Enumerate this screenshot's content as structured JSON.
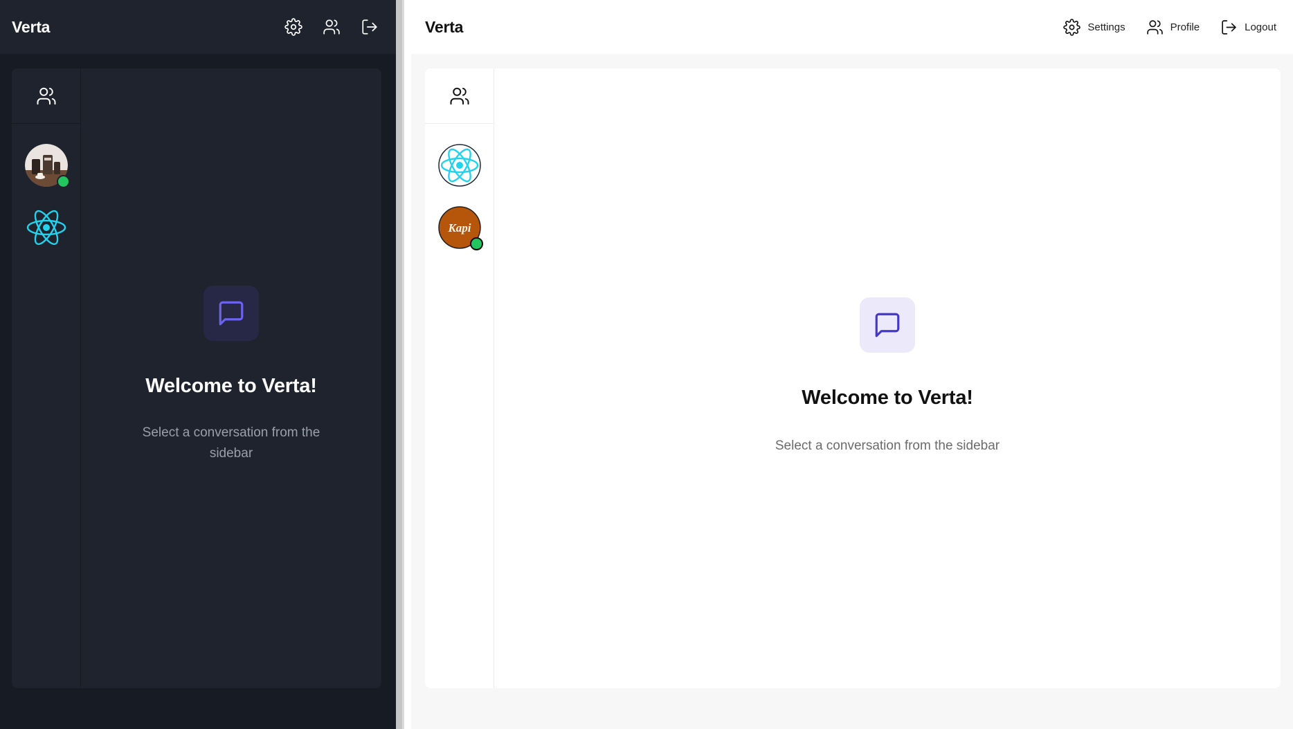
{
  "dark_window": {
    "brand": "Verta",
    "header_icons": [
      "gear-icon",
      "users-icon",
      "logout-icon"
    ],
    "welcome": {
      "title": "Welcome to Verta!",
      "subtitle": "Select a conversation from the sidebar"
    },
    "accent": "#6d63f2"
  },
  "light_window": {
    "brand": "Verta",
    "actions": {
      "settings_label": "Settings",
      "profile_label": "Profile",
      "logout_label": "Logout"
    },
    "welcome": {
      "title": "Welcome to Verta!",
      "subtitle": "Select a conversation from the sidebar"
    },
    "kapi_avatar_text": "Kapi",
    "accent": "#4338ca"
  },
  "colors": {
    "online": "#22c55e",
    "react_cyan": "#22d3ee",
    "kapi_brown": "#b5560b"
  }
}
